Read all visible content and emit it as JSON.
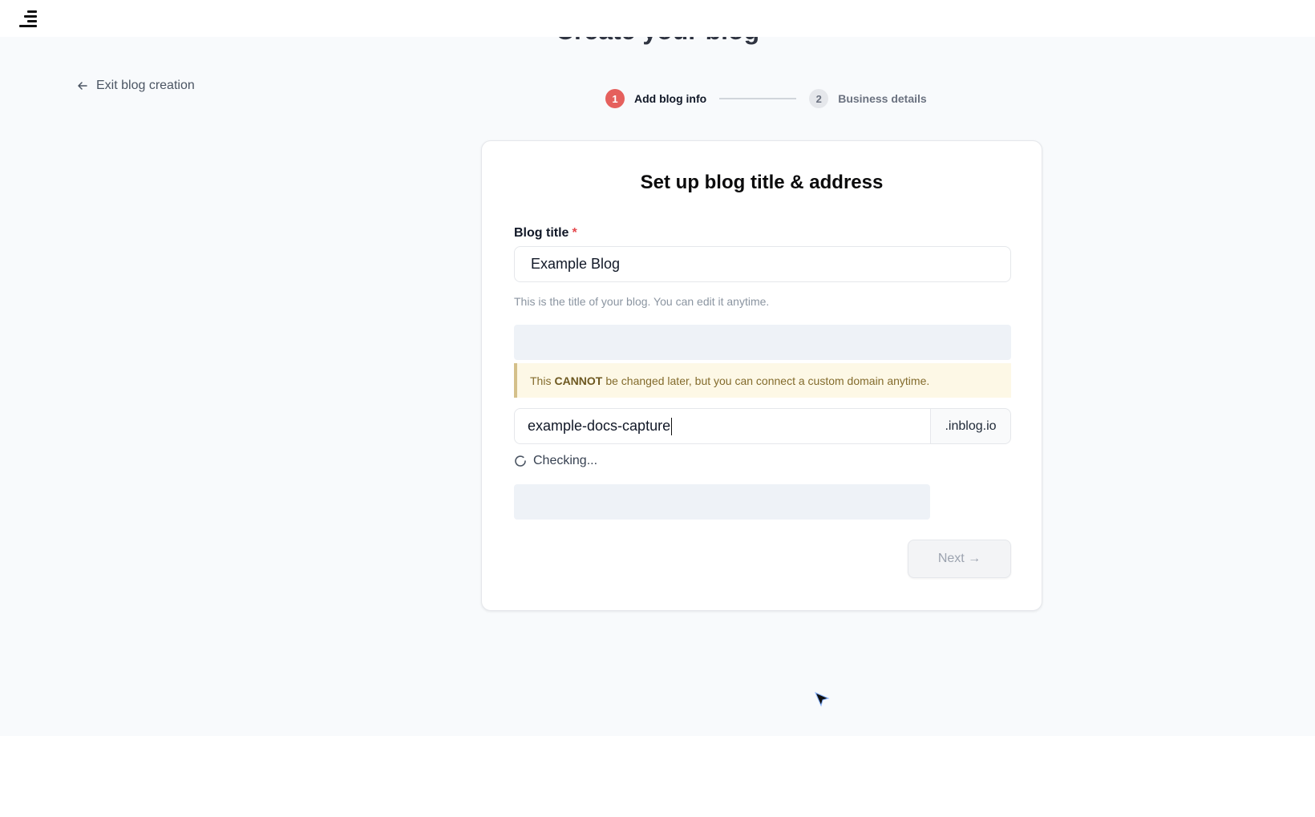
{
  "header": {
    "logo_icon": "hamburger-logo-icon"
  },
  "page": {
    "title": "Create your blog",
    "exit_label": "Exit blog creation"
  },
  "stepper": {
    "steps": [
      {
        "number": "1",
        "label": "Add blog info",
        "state": "active"
      },
      {
        "number": "2",
        "label": "Business details",
        "state": "inactive"
      }
    ]
  },
  "form": {
    "title": "Set up blog title & address",
    "blog_title": {
      "label": "Blog title",
      "required_mark": "*",
      "value": "Example Blog",
      "helper": "This is the title of your blog. You can edit it anytime."
    },
    "warning": {
      "prefix": "This",
      "emphasis": "CANNOT",
      "suffix": "be changed later, but you can connect a custom domain anytime."
    },
    "address": {
      "value": "example-docs-capture",
      "suffix": ".inblog.io"
    },
    "status": {
      "text": "Checking...",
      "icon": "spinner-icon"
    },
    "next_label": "Next →"
  },
  "colors": {
    "accent": "#e5605d",
    "warning_bg": "#fdf8e6",
    "warning_border": "#d4c08a"
  }
}
